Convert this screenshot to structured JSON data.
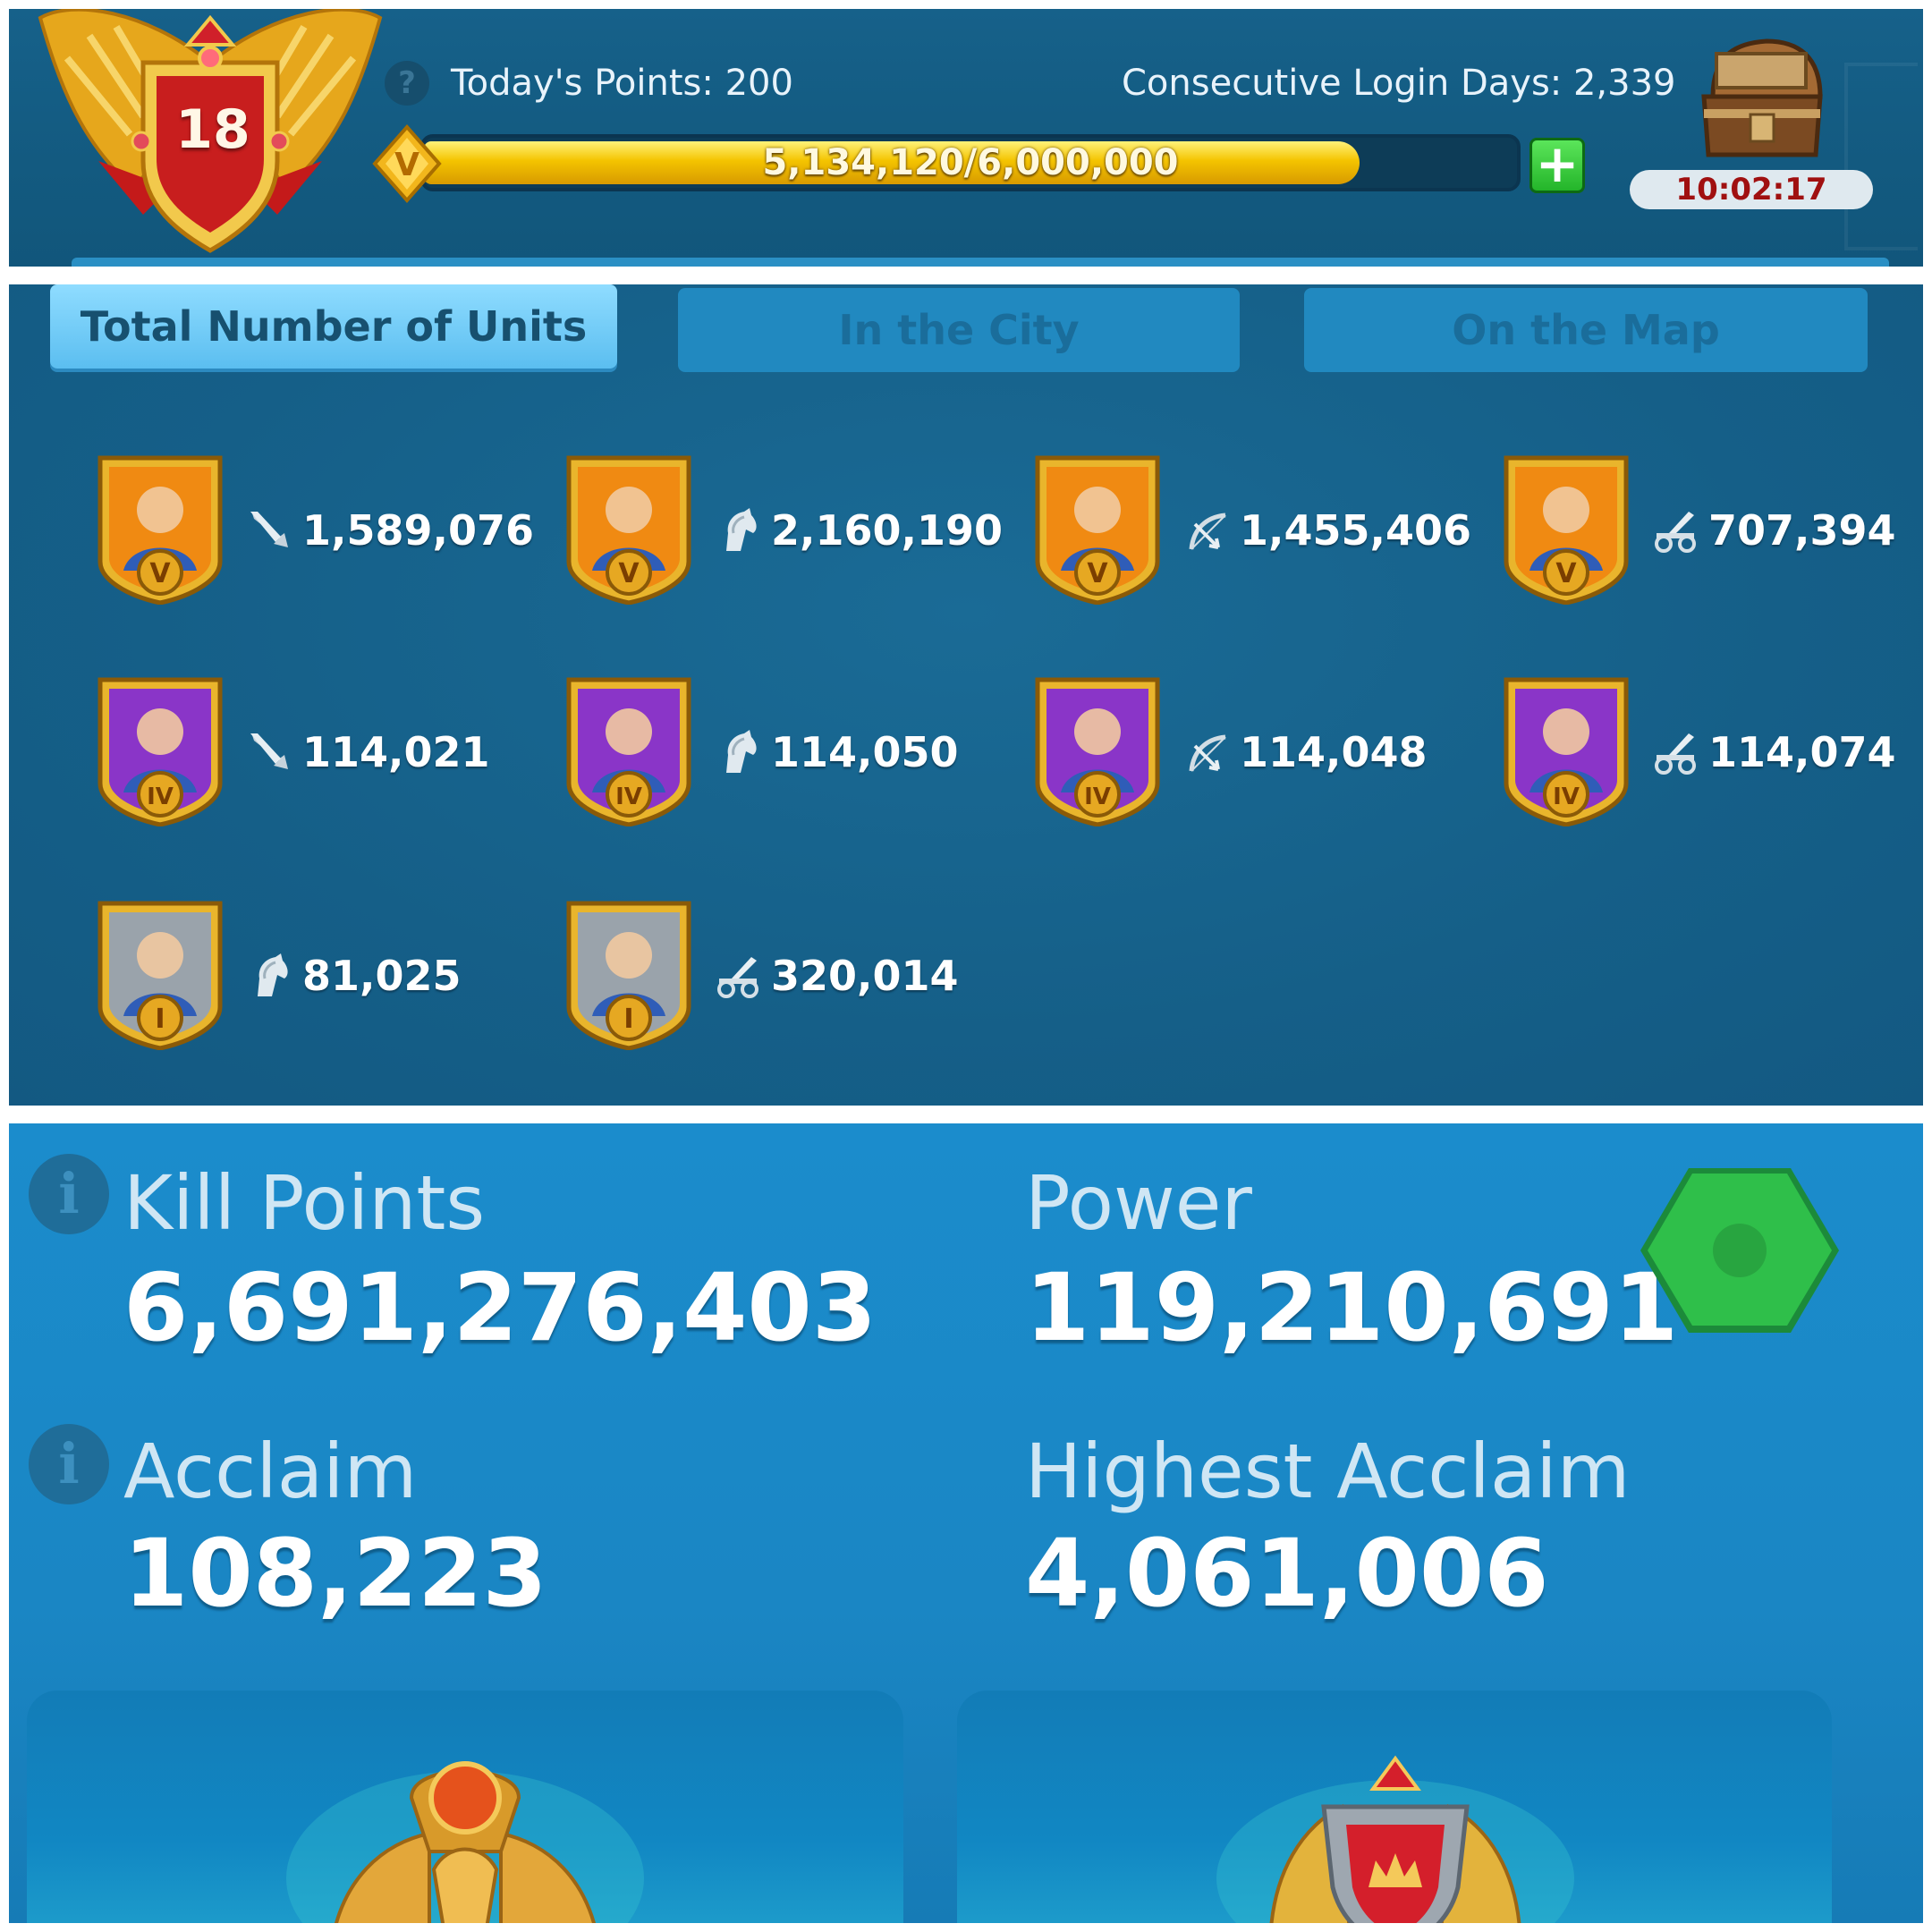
{
  "vip": {
    "level": "18",
    "help_symbol": "?",
    "todays_points": "Today's Points: 200",
    "login_days": "Consecutive Login Days: 2,339",
    "progress_text": "5,134,120/6,000,000",
    "progress_fraction": 0.8557,
    "add_symbol": "+",
    "diamond_letter": "V",
    "chest_timer": "10:02:17"
  },
  "tabs": [
    {
      "label": "Total Number of Units",
      "active": true
    },
    {
      "label": "In the City",
      "active": false
    },
    {
      "label": "On the Map",
      "active": false
    }
  ],
  "units": [
    {
      "tier": "V",
      "type": "infantry-icon",
      "count": "1,589,076",
      "bg": "#f08a12"
    },
    {
      "tier": "V",
      "type": "cavalry-icon",
      "count": "2,160,190",
      "bg": "#f08a12"
    },
    {
      "tier": "V",
      "type": "archer-icon",
      "count": "1,455,406",
      "bg": "#f08a12"
    },
    {
      "tier": "V",
      "type": "siege-icon",
      "count": "707,394",
      "bg": "#f08a12"
    },
    {
      "tier": "IV",
      "type": "infantry-icon",
      "count": "114,021",
      "bg": "#8a35c8"
    },
    {
      "tier": "IV",
      "type": "cavalry-icon",
      "count": "114,050",
      "bg": "#8a35c8"
    },
    {
      "tier": "IV",
      "type": "archer-icon",
      "count": "114,048",
      "bg": "#8a35c8"
    },
    {
      "tier": "IV",
      "type": "siege-icon",
      "count": "114,074",
      "bg": "#8a35c8"
    },
    {
      "tier": "I",
      "type": "cavalry-icon",
      "count": "81,025",
      "bg": "#9aa3ab"
    },
    {
      "tier": "I",
      "type": "siege-icon",
      "count": "320,014",
      "bg": "#9aa3ab"
    }
  ],
  "stats": {
    "info_symbol": "i",
    "kill_points_label": "Kill Points",
    "kill_points_value": "6,691,276,403",
    "power_label": "Power",
    "power_value": "119,210,691",
    "acclaim_label": "Acclaim",
    "acclaim_value": "108,223",
    "highest_acclaim_label": "Highest Acclaim",
    "highest_acclaim_value": "4,061,006"
  },
  "colors": {
    "panel_dark": "#135a80",
    "stats_blue": "#1b8ccc",
    "gold": "#f4c400",
    "add_green": "#24b52a",
    "timer_red": "#a01010",
    "power_hex": "#2fbf4a"
  }
}
